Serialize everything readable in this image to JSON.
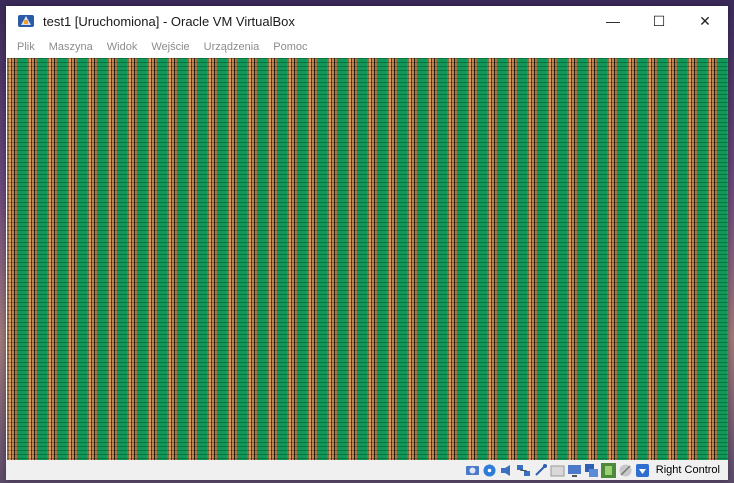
{
  "window": {
    "title": "test1 [Uruchomiona] - Oracle VM VirtualBox",
    "controls": {
      "minimize": "—",
      "maximize": "☐",
      "close": "✕"
    }
  },
  "menu": {
    "items": [
      "Plik",
      "Maszyna",
      "Widok",
      "Wejście",
      "Urządzenia",
      "Pomoc"
    ]
  },
  "statusbar": {
    "icons": [
      "hard-disk-icon",
      "optical-drive-icon",
      "audio-icon",
      "network-icon",
      "usb-icon",
      "shared-folders-icon",
      "display-icon",
      "video-capture-icon",
      "cpu-virtualization-icon",
      "mouse-integration-icon",
      "keyboard-capture-icon"
    ],
    "host_key": "Right Control"
  },
  "colors": {
    "guest_green": "#109858",
    "guest_brown": "#9c6a3c",
    "statusbar_bg": "#f0f0f0",
    "menu_text": "#8c8c8c"
  }
}
